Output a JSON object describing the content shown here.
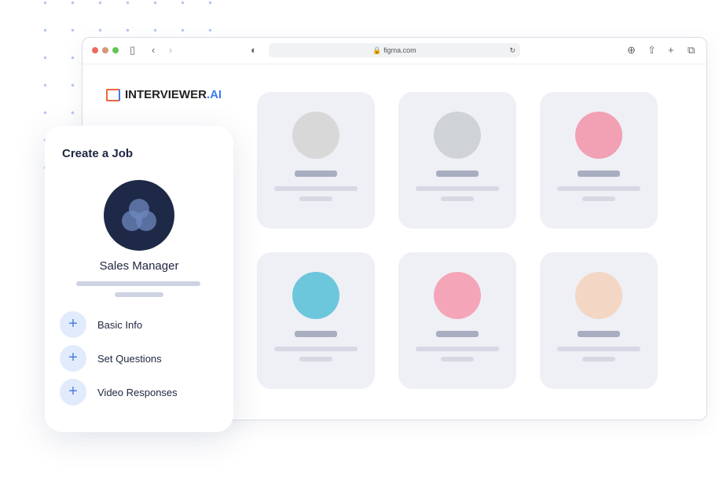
{
  "browser": {
    "url": "figma.com"
  },
  "logo": {
    "name": "INTERVIEWER",
    "suffix": ".AI"
  },
  "candidates": [
    {
      "avatar_color": "#d8d8d8"
    },
    {
      "avatar_color": "#cfd3d8"
    },
    {
      "avatar_color": "#f2a0b4"
    },
    {
      "avatar_color": "#6cc6dc"
    },
    {
      "avatar_color": "#f4a6b8"
    },
    {
      "avatar_color": "#f3d6c4"
    }
  ],
  "panel": {
    "title": "Create a Job",
    "job_name": "Sales Manager",
    "steps": [
      {
        "label": "Basic Info"
      },
      {
        "label": "Set Questions"
      },
      {
        "label": "Video Responses"
      }
    ]
  }
}
